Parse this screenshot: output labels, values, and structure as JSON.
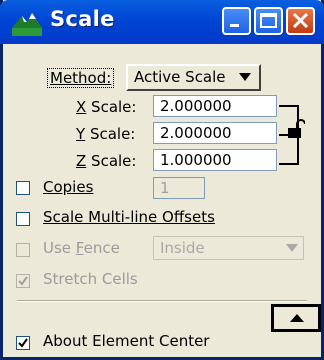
{
  "window": {
    "title": "Scale",
    "icon": "scale-tool-icon",
    "controls": [
      "minimize-icon",
      "maximize-icon",
      "close-icon"
    ]
  },
  "method": {
    "label": "Method:",
    "selected": "Active Scale"
  },
  "scales": [
    {
      "label_key": "X",
      "label_rest": " Scale:",
      "value": "2.000000"
    },
    {
      "label_key": "Y",
      "label_rest": " Scale:",
      "value": "2.000000"
    },
    {
      "label_key": "Z",
      "label_rest": " Scale:",
      "value": "1.000000"
    }
  ],
  "lock": {
    "icon": "lock-icon",
    "state": "locked"
  },
  "copies": {
    "label": "Copies",
    "checked": false,
    "value": "1"
  },
  "scale_multiline": {
    "label": "Scale Multi-line Offsets",
    "checked": false
  },
  "use_fence": {
    "label_pre": "Use ",
    "label_key": "F",
    "label_rest": "ence",
    "checked": false,
    "enabled": false,
    "mode": "Inside"
  },
  "stretch_cells": {
    "label": "Stretch Cells",
    "checked": true,
    "enabled": false
  },
  "about_center": {
    "label": "About Element Center",
    "checked": true
  },
  "collapse_button": {
    "icon": "triangle-up-icon"
  }
}
